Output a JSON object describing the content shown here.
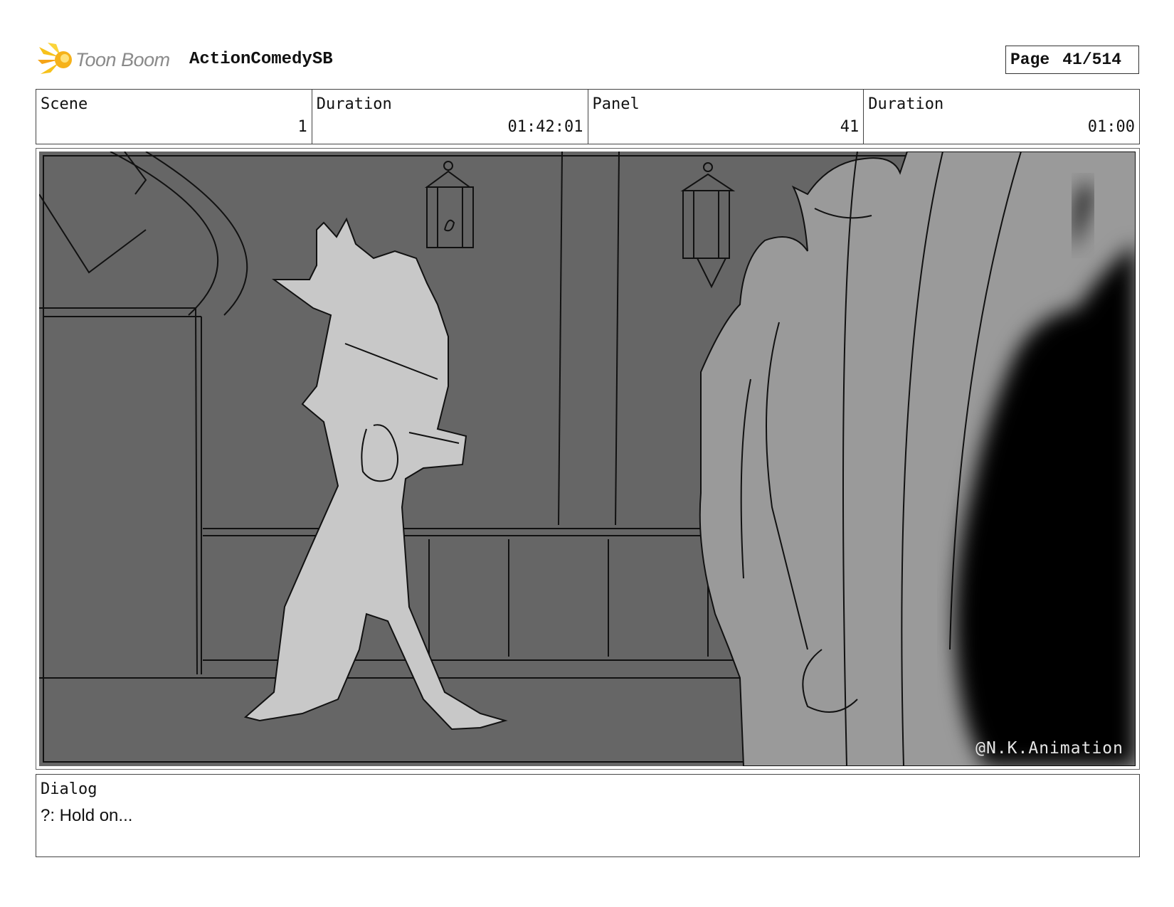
{
  "header": {
    "logo_text": "Toon Boom",
    "project_title": "ActionComedySB",
    "page_label": "Page",
    "page_value": "41/514"
  },
  "info": {
    "scene_label": "Scene",
    "scene_value": "1",
    "scene_duration_label": "Duration",
    "scene_duration_value": "01:42:01",
    "panel_label": "Panel",
    "panel_value": "41",
    "panel_duration_label": "Duration",
    "panel_duration_value": "01:00"
  },
  "panel": {
    "watermark": "@N.K.Animation"
  },
  "dialog": {
    "label": "Dialog",
    "text": "?: Hold on..."
  }
}
